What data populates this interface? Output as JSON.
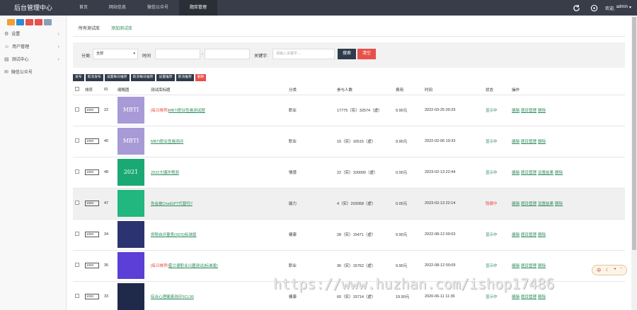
{
  "app": {
    "title": "后台管理中心",
    "nav": [
      "首页",
      "网站信息",
      "微信公众号",
      "题库管理"
    ],
    "active_nav": 3,
    "welcome": "欢迎,",
    "user": "admin"
  },
  "sidebar": {
    "quick_buttons": [
      {
        "icon": "home-icon",
        "color": "#f0a030"
      },
      {
        "icon": "file-icon",
        "color": "#2a8cd6"
      },
      {
        "icon": "user-icon",
        "color": "#e8504a"
      },
      {
        "icon": "refresh-icon",
        "color": "#e8504a"
      },
      {
        "icon": "list-icon",
        "color": "#8aa0b8"
      }
    ],
    "items": [
      {
        "label": "设置",
        "icon": "gear-icon",
        "expandable": true
      },
      {
        "label": "用户管理",
        "icon": "users-icon",
        "expandable": true
      },
      {
        "label": "测试中心",
        "icon": "test-icon",
        "expandable": true
      },
      {
        "label": "微信公众号",
        "icon": "wechat-icon",
        "expandable": false
      }
    ]
  },
  "tabs": [
    "所有测试库",
    "添加测试库"
  ],
  "filter": {
    "category_label": "分类:",
    "category_value": "全部",
    "time_label": "时间",
    "date_separator": "-",
    "keyword_label": "关键字:",
    "keyword_placeholder": "请输入关键字...",
    "search_button": "搜索",
    "reset_button": "清空"
  },
  "actions": [
    "发布",
    "取消发布",
    "设置每日推荐",
    "取消每日推荐",
    "设置推荐",
    "取消推荐",
    "删除"
  ],
  "table": {
    "headers": [
      "",
      "排序",
      "ID",
      "缩略图",
      "测试库标题",
      "分类",
      "参与人数",
      "费用",
      "时间",
      "状态",
      "操作"
    ],
    "rows": [
      {
        "sort": "1000",
        "id": "22",
        "thumb_text": "MBTI",
        "thumb_color": "#a89ad6",
        "tag": "[每日推荐]",
        "title": "MBTI职业性格测试题",
        "category": "职业",
        "participants": "17775（实）32574（虚）",
        "fee": "9.90元",
        "time": "2022-03-25 00:29",
        "status": "显示中",
        "status_on": true,
        "ops": [
          "编辑",
          "题目管理",
          "删除"
        ]
      },
      {
        "sort": "1000",
        "id": "40",
        "thumb_text": "MBTI",
        "thumb_color": "#a89ad6",
        "tag": "",
        "title": "MBTI职业性格测评",
        "category": "职业",
        "participants": "15（实）16515（虚）",
        "fee": "9.90元",
        "time": "2022-02-06 19:33",
        "status": "显示中",
        "status_on": true,
        "ops": [
          "编辑",
          "题目管理",
          "删除"
        ]
      },
      {
        "sort": "1000",
        "id": "48",
        "thumb_text": "2021",
        "thumb_color": "#1aa874",
        "tag": "",
        "title": "2022大爆炸预测",
        "category": "情感",
        "participants": "22（实）100000（虚）",
        "fee": "0.00元",
        "time": "2023-02-13 22:44",
        "status": "显示中",
        "status_on": true,
        "ops": [
          "编辑",
          "题目管理",
          "设置结果",
          "删除"
        ]
      },
      {
        "sort": "1000",
        "id": "47",
        "thumb_text": "",
        "thumb_color": "#21b77e",
        "tag": "",
        "title": "你会被ChatGPT代替吗?",
        "category": "能力",
        "participants": "4（实）203058（虚）",
        "fee": "0.00元",
        "time": "2023-02-13 22:14",
        "status": "隐藏中",
        "status_on": false,
        "ops": [
          "编辑",
          "题目管理",
          "设置结果",
          "删除"
        ]
      },
      {
        "sort": "1000",
        "id": "34",
        "thumb_text": "",
        "thumb_color": "#2b3470",
        "tag": "",
        "title": "抑郁自评量表(SDS)标准版",
        "category": "健康",
        "participants": "28（实）15471（虚）",
        "fee": "9.90元",
        "time": "2022-08-12 00:03",
        "status": "显示中",
        "status_on": true,
        "ops": [
          "编辑",
          "题目管理",
          "删除"
        ]
      },
      {
        "sort": "1000",
        "id": "35",
        "thumb_text": "",
        "thumb_color": "#5b3fd6",
        "tag": "[每日推荐]",
        "title": "霍兰德职业兴趣测试(标准版)",
        "category": "职业",
        "participants": "36（实）15762（虚）",
        "fee": "9.90元",
        "time": "2022-08-12 00:09",
        "status": "显示中",
        "status_on": true,
        "ops": [
          "编辑",
          "题目管理",
          "删除"
        ]
      },
      {
        "sort": "1000",
        "id": "33",
        "thumb_text": "",
        "thumb_color": "#1f2a4a",
        "tag": "",
        "title": "综合心理健康测评SCL90",
        "category": "健康",
        "participants": "60（实）15714（虚）",
        "fee": "19.90元",
        "time": "2020-06-11 11:36",
        "status": "显示中",
        "status_on": true,
        "ops": [
          "编辑",
          "题目管理",
          "删除"
        ]
      }
    ]
  },
  "float_widget": {
    "text": "中",
    "icons": [
      "moon-icon",
      "quote-icon",
      "chevron-icon"
    ]
  },
  "watermark": "https://www.huzhan.com/ishop17486"
}
